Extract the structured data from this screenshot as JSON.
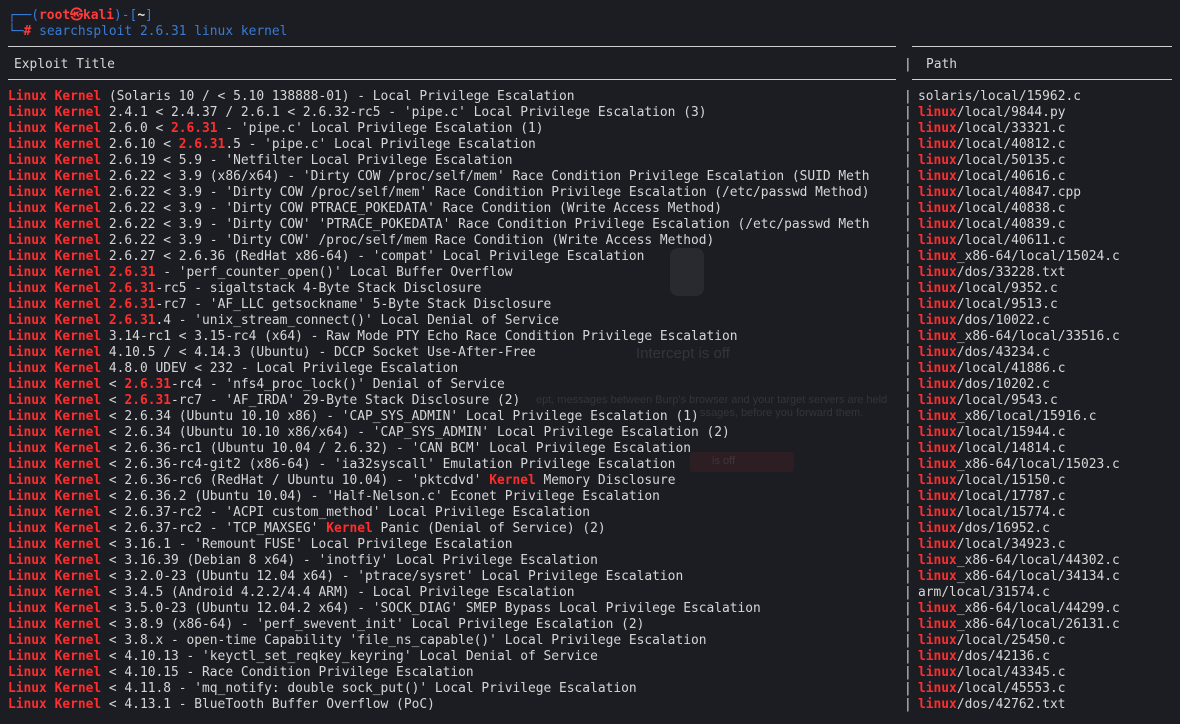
{
  "prompt": {
    "line1_prefix": "┌──(",
    "user_host": "root㉿kali",
    "line1_mid": ")-[",
    "cwd": "~",
    "line1_suffix": "]",
    "line2_prefix": "└─",
    "hash": "#",
    "command": "searchsploit 2.6.31 linux kernel"
  },
  "table": {
    "header_title": "Exploit Title",
    "header_bar": "|",
    "header_path": "Path",
    "rows": [
      {
        "title": [
          {
            "t": "Linux Kernel",
            "h": true
          },
          {
            "t": " (Solaris 10 / < 5.10 138888-01) - Local Privilege Escalation"
          }
        ],
        "path": [
          {
            "t": "solaris/local/15962.c"
          }
        ]
      },
      {
        "title": [
          {
            "t": "Linux Kernel",
            "h": true
          },
          {
            "t": " 2.4.1 < 2.4.37 / 2.6.1 < 2.6.32-rc5 - 'pipe.c' Local Privilege Escalation (3)"
          }
        ],
        "path": [
          {
            "t": "linux",
            "h": true
          },
          {
            "t": "/local/9844.py"
          }
        ]
      },
      {
        "title": [
          {
            "t": "Linux Kernel",
            "h": true
          },
          {
            "t": " 2.6.0 < "
          },
          {
            "t": "2.6.31",
            "h": true
          },
          {
            "t": " - 'pipe.c' Local Privilege Escalation (1)"
          }
        ],
        "path": [
          {
            "t": "linux",
            "h": true
          },
          {
            "t": "/local/33321.c"
          }
        ]
      },
      {
        "title": [
          {
            "t": "Linux Kernel",
            "h": true
          },
          {
            "t": " 2.6.10 < "
          },
          {
            "t": "2.6.31",
            "h": true
          },
          {
            "t": ".5 - 'pipe.c' Local Privilege Escalation"
          }
        ],
        "path": [
          {
            "t": "linux",
            "h": true
          },
          {
            "t": "/local/40812.c"
          }
        ]
      },
      {
        "title": [
          {
            "t": "Linux Kernel",
            "h": true
          },
          {
            "t": " 2.6.19 < 5.9 - 'Netfilter Local Privilege Escalation"
          }
        ],
        "path": [
          {
            "t": "linux",
            "h": true
          },
          {
            "t": "/local/50135.c"
          }
        ]
      },
      {
        "title": [
          {
            "t": "Linux Kernel",
            "h": true
          },
          {
            "t": " 2.6.22 < 3.9 (x86/x64) - 'Dirty COW /proc/self/mem' Race Condition Privilege Escalation (SUID Meth"
          }
        ],
        "path": [
          {
            "t": "linux",
            "h": true
          },
          {
            "t": "/local/40616.c"
          }
        ]
      },
      {
        "title": [
          {
            "t": "Linux Kernel",
            "h": true
          },
          {
            "t": " 2.6.22 < 3.9 - 'Dirty COW /proc/self/mem' Race Condition Privilege Escalation (/etc/passwd Method)"
          }
        ],
        "path": [
          {
            "t": "linux",
            "h": true
          },
          {
            "t": "/local/40847.cpp"
          }
        ]
      },
      {
        "title": [
          {
            "t": "Linux Kernel",
            "h": true
          },
          {
            "t": " 2.6.22 < 3.9 - 'Dirty COW PTRACE_POKEDATA' Race Condition (Write Access Method)"
          }
        ],
        "path": [
          {
            "t": "linux",
            "h": true
          },
          {
            "t": "/local/40838.c"
          }
        ]
      },
      {
        "title": [
          {
            "t": "Linux Kernel",
            "h": true
          },
          {
            "t": " 2.6.22 < 3.9 - 'Dirty COW' 'PTRACE_POKEDATA' Race Condition Privilege Escalation (/etc/passwd Meth"
          }
        ],
        "path": [
          {
            "t": "linux",
            "h": true
          },
          {
            "t": "/local/40839.c"
          }
        ]
      },
      {
        "title": [
          {
            "t": "Linux Kernel",
            "h": true
          },
          {
            "t": " 2.6.22 < 3.9 - 'Dirty COW' /proc/self/mem Race Condition (Write Access Method)"
          }
        ],
        "path": [
          {
            "t": "linux",
            "h": true
          },
          {
            "t": "/local/40611.c"
          }
        ]
      },
      {
        "title": [
          {
            "t": "Linux Kernel",
            "h": true
          },
          {
            "t": " 2.6.27 < 2.6.36 (RedHat x86-64) - 'compat' Local Privilege Escalation"
          }
        ],
        "path": [
          {
            "t": "linux",
            "h": true
          },
          {
            "t": "_x86-64/local/15024.c"
          }
        ]
      },
      {
        "title": [
          {
            "t": "Linux Kernel",
            "h": true
          },
          {
            "t": " "
          },
          {
            "t": "2.6.31",
            "h": true
          },
          {
            "t": " - 'perf_counter_open()' Local Buffer Overflow"
          }
        ],
        "path": [
          {
            "t": "linux",
            "h": true
          },
          {
            "t": "/dos/33228.txt"
          }
        ]
      },
      {
        "title": [
          {
            "t": "Linux Kernel",
            "h": true
          },
          {
            "t": " "
          },
          {
            "t": "2.6.31",
            "h": true
          },
          {
            "t": "-rc5 - sigaltstack 4-Byte Stack Disclosure"
          }
        ],
        "path": [
          {
            "t": "linux",
            "h": true
          },
          {
            "t": "/local/9352.c"
          }
        ]
      },
      {
        "title": [
          {
            "t": "Linux Kernel",
            "h": true
          },
          {
            "t": " "
          },
          {
            "t": "2.6.31",
            "h": true
          },
          {
            "t": "-rc7 - 'AF_LLC getsockname' 5-Byte Stack Disclosure"
          }
        ],
        "path": [
          {
            "t": "linux",
            "h": true
          },
          {
            "t": "/local/9513.c"
          }
        ]
      },
      {
        "title": [
          {
            "t": "Linux Kernel",
            "h": true
          },
          {
            "t": " "
          },
          {
            "t": "2.6.31",
            "h": true
          },
          {
            "t": ".4 - 'unix_stream_connect()' Local Denial of Service"
          }
        ],
        "path": [
          {
            "t": "linux",
            "h": true
          },
          {
            "t": "/dos/10022.c"
          }
        ]
      },
      {
        "title": [
          {
            "t": "Linux Kernel",
            "h": true
          },
          {
            "t": " 3.14-rc1 < 3.15-rc4 (x64) - Raw Mode PTY Echo Race Condition Privilege Escalation"
          }
        ],
        "path": [
          {
            "t": "linux",
            "h": true
          },
          {
            "t": "_x86-64/local/33516.c"
          }
        ]
      },
      {
        "title": [
          {
            "t": "Linux Kernel",
            "h": true
          },
          {
            "t": " 4.10.5 / < 4.14.3 (Ubuntu) - DCCP Socket Use-After-Free"
          }
        ],
        "path": [
          {
            "t": "linux",
            "h": true
          },
          {
            "t": "/dos/43234.c"
          }
        ]
      },
      {
        "title": [
          {
            "t": "Linux Kernel",
            "h": true
          },
          {
            "t": " 4.8.0 UDEV < 232 - Local Privilege Escalation"
          }
        ],
        "path": [
          {
            "t": "linux",
            "h": true
          },
          {
            "t": "/local/41886.c"
          }
        ]
      },
      {
        "title": [
          {
            "t": "Linux Kernel",
            "h": true
          },
          {
            "t": " < "
          },
          {
            "t": "2.6.31",
            "h": true
          },
          {
            "t": "-rc4 - 'nfs4_proc_lock()' Denial of Service"
          }
        ],
        "path": [
          {
            "t": "linux",
            "h": true
          },
          {
            "t": "/dos/10202.c"
          }
        ]
      },
      {
        "title": [
          {
            "t": "Linux Kernel",
            "h": true
          },
          {
            "t": " < "
          },
          {
            "t": "2.6.31",
            "h": true
          },
          {
            "t": "-rc7 - 'AF_IRDA' 29-Byte Stack Disclosure (2)"
          }
        ],
        "path": [
          {
            "t": "linux",
            "h": true
          },
          {
            "t": "/local/9543.c"
          }
        ]
      },
      {
        "title": [
          {
            "t": "Linux Kernel",
            "h": true
          },
          {
            "t": " < 2.6.34 (Ubuntu 10.10 x86) - 'CAP_SYS_ADMIN' Local Privilege Escalation (1)"
          }
        ],
        "path": [
          {
            "t": "linux",
            "h": true
          },
          {
            "t": "_x86/local/15916.c"
          }
        ]
      },
      {
        "title": [
          {
            "t": "Linux Kernel",
            "h": true
          },
          {
            "t": " < 2.6.34 (Ubuntu 10.10 x86/x64) - 'CAP_SYS_ADMIN' Local Privilege Escalation (2)"
          }
        ],
        "path": [
          {
            "t": "linux",
            "h": true
          },
          {
            "t": "/local/15944.c"
          }
        ]
      },
      {
        "title": [
          {
            "t": "Linux Kernel",
            "h": true
          },
          {
            "t": " < 2.6.36-rc1 (Ubuntu 10.04 / 2.6.32) - 'CAN BCM' Local Privilege Escalation"
          }
        ],
        "path": [
          {
            "t": "linux",
            "h": true
          },
          {
            "t": "/local/14814.c"
          }
        ]
      },
      {
        "title": [
          {
            "t": "Linux Kernel",
            "h": true
          },
          {
            "t": " < 2.6.36-rc4-git2 (x86-64) - 'ia32syscall' Emulation Privilege Escalation"
          }
        ],
        "path": [
          {
            "t": "linux",
            "h": true
          },
          {
            "t": "_x86-64/local/15023.c"
          }
        ]
      },
      {
        "title": [
          {
            "t": "Linux Kernel",
            "h": true
          },
          {
            "t": " < 2.6.36-rc6 (RedHat / Ubuntu 10.04) - 'pktcdvd' "
          },
          {
            "t": "Kernel",
            "h": true
          },
          {
            "t": " Memory Disclosure"
          }
        ],
        "path": [
          {
            "t": "linux",
            "h": true
          },
          {
            "t": "/local/15150.c"
          }
        ]
      },
      {
        "title": [
          {
            "t": "Linux Kernel",
            "h": true
          },
          {
            "t": " < 2.6.36.2 (Ubuntu 10.04) - 'Half-Nelson.c' Econet Privilege Escalation"
          }
        ],
        "path": [
          {
            "t": "linux",
            "h": true
          },
          {
            "t": "/local/17787.c"
          }
        ]
      },
      {
        "title": [
          {
            "t": "Linux Kernel",
            "h": true
          },
          {
            "t": " < 2.6.37-rc2 - 'ACPI custom_method' Local Privilege Escalation"
          }
        ],
        "path": [
          {
            "t": "linux",
            "h": true
          },
          {
            "t": "/local/15774.c"
          }
        ]
      },
      {
        "title": [
          {
            "t": "Linux Kernel",
            "h": true
          },
          {
            "t": " < 2.6.37-rc2 - 'TCP_MAXSEG' "
          },
          {
            "t": "Kernel",
            "h": true
          },
          {
            "t": " Panic (Denial of Service) (2)"
          }
        ],
        "path": [
          {
            "t": "linux",
            "h": true
          },
          {
            "t": "/dos/16952.c"
          }
        ]
      },
      {
        "title": [
          {
            "t": "Linux Kernel",
            "h": true
          },
          {
            "t": " < 3.16.1 - 'Remount FUSE' Local Privilege Escalation"
          }
        ],
        "path": [
          {
            "t": "linux",
            "h": true
          },
          {
            "t": "/local/34923.c"
          }
        ]
      },
      {
        "title": [
          {
            "t": "Linux Kernel",
            "h": true
          },
          {
            "t": " < 3.16.39 (Debian 8 x64) - 'inotfiy' Local Privilege Escalation"
          }
        ],
        "path": [
          {
            "t": "linux",
            "h": true
          },
          {
            "t": "_x86-64/local/44302.c"
          }
        ]
      },
      {
        "title": [
          {
            "t": "Linux Kernel",
            "h": true
          },
          {
            "t": " < 3.2.0-23 (Ubuntu 12.04 x64) - 'ptrace/sysret' Local Privilege Escalation"
          }
        ],
        "path": [
          {
            "t": "linux",
            "h": true
          },
          {
            "t": "_x86-64/local/34134.c"
          }
        ]
      },
      {
        "title": [
          {
            "t": "Linux Kernel",
            "h": true
          },
          {
            "t": " < 3.4.5 (Android 4.2.2/4.4 ARM) - Local Privilege Escalation"
          }
        ],
        "path": [
          {
            "t": "arm/local/31574.c"
          }
        ]
      },
      {
        "title": [
          {
            "t": "Linux Kernel",
            "h": true
          },
          {
            "t": " < 3.5.0-23 (Ubuntu 12.04.2 x64) - 'SOCK_DIAG' SMEP Bypass Local Privilege Escalation"
          }
        ],
        "path": [
          {
            "t": "linux",
            "h": true
          },
          {
            "t": "_x86-64/local/44299.c"
          }
        ]
      },
      {
        "title": [
          {
            "t": "Linux Kernel",
            "h": true
          },
          {
            "t": " < 3.8.9 (x86-64) - 'perf_swevent_init' Local Privilege Escalation (2)"
          }
        ],
        "path": [
          {
            "t": "linux",
            "h": true
          },
          {
            "t": "_x86-64/local/26131.c"
          }
        ]
      },
      {
        "title": [
          {
            "t": "Linux Kernel",
            "h": true
          },
          {
            "t": " < 3.8.x - open-time Capability 'file_ns_capable()' Local Privilege Escalation"
          }
        ],
        "path": [
          {
            "t": "linux",
            "h": true
          },
          {
            "t": "/local/25450.c"
          }
        ]
      },
      {
        "title": [
          {
            "t": "Linux Kernel",
            "h": true
          },
          {
            "t": " < 4.10.13 - 'keyctl_set_reqkey_keyring' Local Denial of Service"
          }
        ],
        "path": [
          {
            "t": "linux",
            "h": true
          },
          {
            "t": "/dos/42136.c"
          }
        ]
      },
      {
        "title": [
          {
            "t": "Linux Kernel",
            "h": true
          },
          {
            "t": " < 4.10.15 - Race Condition Privilege Escalation"
          }
        ],
        "path": [
          {
            "t": "linux",
            "h": true
          },
          {
            "t": "/local/43345.c"
          }
        ]
      },
      {
        "title": [
          {
            "t": "Linux Kernel",
            "h": true
          },
          {
            "t": " < 4.11.8 - 'mq_notify: double sock_put()' Local Privilege Escalation"
          }
        ],
        "path": [
          {
            "t": "linux",
            "h": true
          },
          {
            "t": "/local/45553.c"
          }
        ]
      },
      {
        "title": [
          {
            "t": "Linux Kernel",
            "h": true
          },
          {
            "t": " < 4.13.1 - BlueTooth Buffer Overflow (PoC)"
          }
        ],
        "path": [
          {
            "t": "linux",
            "h": true
          },
          {
            "t": "/dos/42762.txt"
          }
        ]
      }
    ]
  },
  "ghost_overlay": {
    "heading": "Intercept is off",
    "line1": "ept, messages between Burp's browser and your target servers are held",
    "line2": "ssages, before you forward them.",
    "button": "is off"
  },
  "colors": {
    "background": "#1b1d22",
    "highlight_red": "#ff2d2d",
    "prompt_blue": "#3a7bd5",
    "text": "#d6d6d6"
  }
}
